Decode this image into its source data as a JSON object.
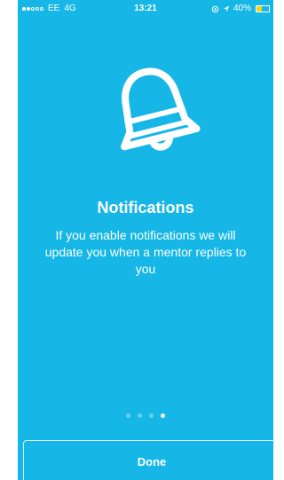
{
  "status_bar": {
    "carrier": "EE",
    "network": "4G",
    "time": "13:21",
    "battery_percent": "40%",
    "signal_bars_filled": 2,
    "signal_bars_total": 5,
    "battery_level": 0.4,
    "battery_color": "#f4d21c"
  },
  "onboarding": {
    "icon": "bell-icon",
    "title": "Notifications",
    "message": "If you enable notifications we will update you when a mentor replies to you",
    "pages_total": 4,
    "active_page": 4,
    "done_label": "Done"
  },
  "colors": {
    "background": "#16b7e6",
    "foreground": "#ffffff"
  }
}
